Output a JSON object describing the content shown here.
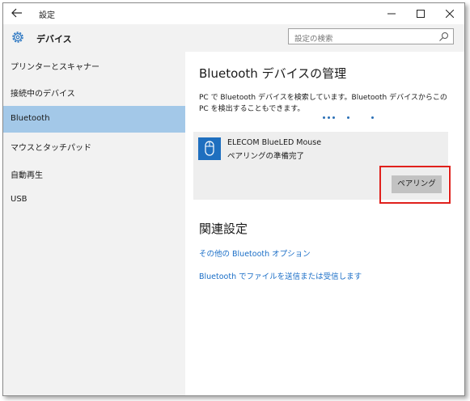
{
  "window": {
    "title": "設定",
    "back_icon": "back-arrow-icon",
    "minimize_icon": "minimize-icon",
    "maximize_icon": "maximize-icon",
    "close_icon": "close-icon"
  },
  "sidebar": {
    "header_icon": "gear-icon",
    "title": "デバイス",
    "items": [
      {
        "label": "プリンターとスキャナー",
        "active": false
      },
      {
        "label": "接続中のデバイス",
        "active": false
      },
      {
        "label": "Bluetooth",
        "active": true
      },
      {
        "label": "マウスとタッチパッド",
        "active": false
      },
      {
        "label": "自動再生",
        "active": false
      },
      {
        "label": "USB",
        "active": false
      }
    ]
  },
  "search": {
    "placeholder": "設定の検索",
    "icon": "search-icon"
  },
  "main": {
    "heading": "Bluetooth デバイスの管理",
    "description": "PC で Bluetooth デバイスを検索しています。Bluetooth デバイスからこの PC を検出することもできます。",
    "device": {
      "icon": "mouse-icon",
      "name": "ELECOM BlueLED Mouse",
      "status": "ペアリングの準備完了",
      "pair_button": "ペアリング"
    },
    "related_heading": "関連設定",
    "links": [
      "その他の Bluetooth オプション",
      "Bluetooth でファイルを送信または受信します"
    ]
  },
  "colors": {
    "accent": "#1a6ec7",
    "active_nav": "#a3c8e8",
    "highlight": "#e0201c",
    "device_icon_bg": "#1f6fbf"
  }
}
